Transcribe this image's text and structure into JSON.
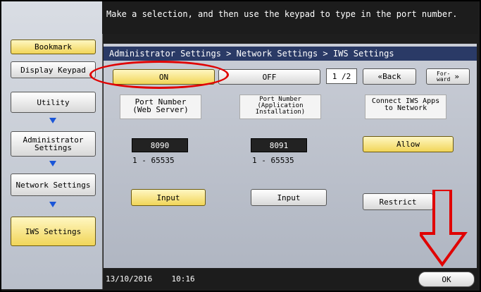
{
  "instruction": "Make a selection, and then use the keypad to type in the port number.",
  "sidebar": {
    "bookmark": "Bookmark",
    "display_keypad": "Display Keypad",
    "items": [
      "Utility",
      "Administrator Settings",
      "Network Settings",
      "IWS Settings"
    ]
  },
  "breadcrumb": "Administrator Settings > Network Settings > IWS Settings",
  "toggle": {
    "on": "ON",
    "off": "OFF"
  },
  "pager": {
    "page": "1 /2",
    "back": "Back",
    "forward": "For-\nward"
  },
  "columns": [
    {
      "header": "Port Number\n(Web Server)",
      "value": "8090",
      "range_min": "1",
      "range_max": "65535",
      "button": "Input"
    },
    {
      "header": "Port Number\n(Application\nInstallation)",
      "value": "8091",
      "range_min": "1",
      "range_max": "65535",
      "button": "Input"
    },
    {
      "header": "Connect IWS Apps\nto Network",
      "allow": "Allow",
      "restrict": "Restrict"
    }
  ],
  "status": {
    "date": "13/10/2016",
    "time": "10:16"
  },
  "ok_button": "OK",
  "colors": {
    "highlight_red": "#e00000",
    "selected_yellow": "#f1d558",
    "arrow_blue": "#1a56d8"
  }
}
